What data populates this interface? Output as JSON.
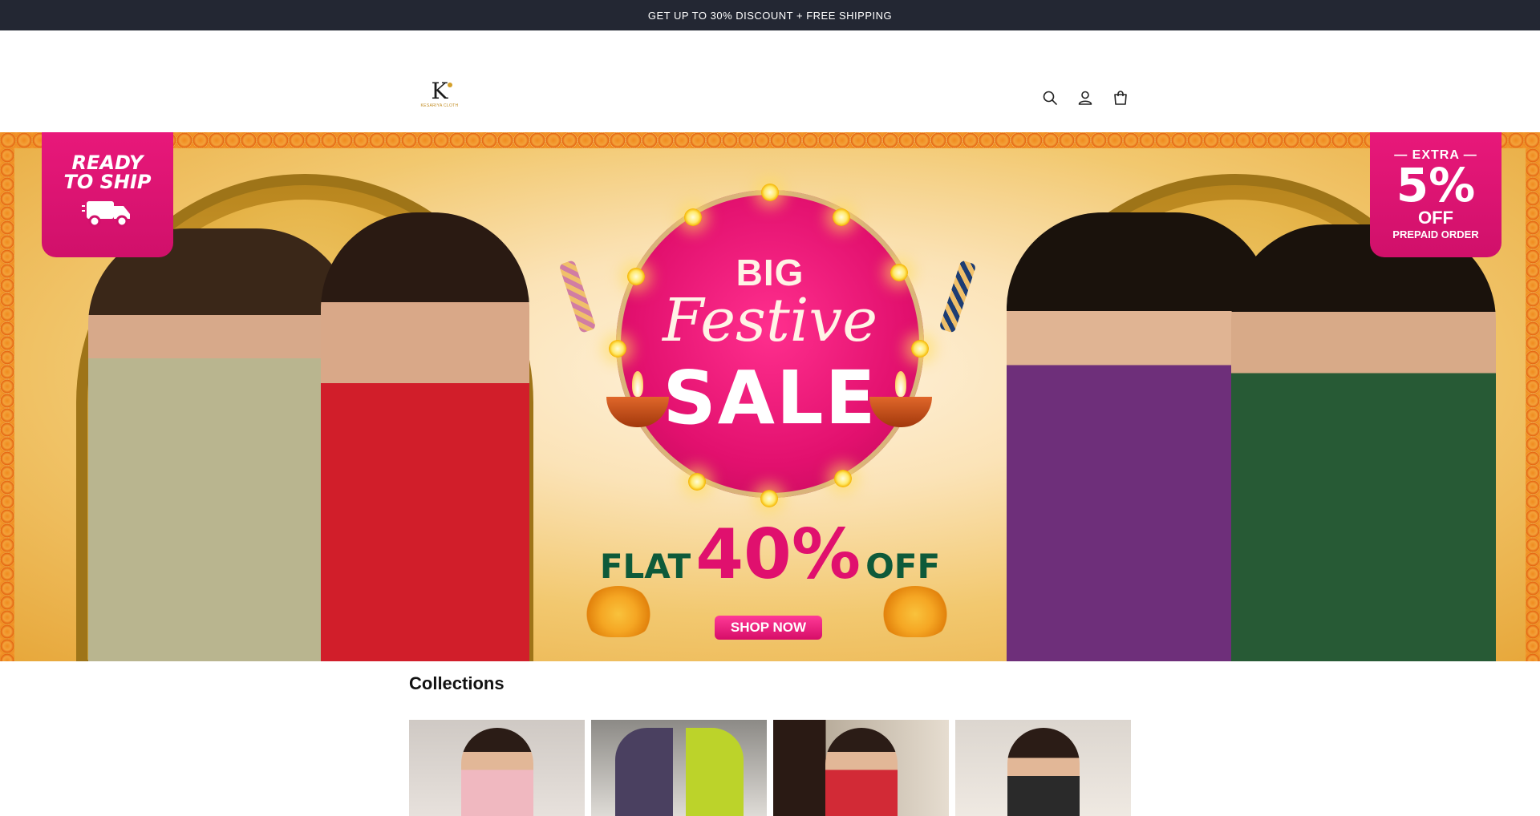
{
  "announcement": {
    "text": "GET UP TO 30% DISCOUNT + FREE SHIPPING"
  },
  "header": {
    "logo_monogram": "K",
    "logo_name": "KESARIYA CLOTH",
    "icons": [
      "search-icon",
      "account-icon",
      "cart-icon"
    ]
  },
  "banner": {
    "badge_left": {
      "line1": "READY",
      "line2": "TO SHIP"
    },
    "badge_right": {
      "extra": "— EXTRA —",
      "big": "5%",
      "off": "OFF",
      "note": "PREPAID ORDER"
    },
    "big": "BIG",
    "festive": "Festive",
    "sale": "SALE",
    "flat": "FLAT",
    "percent": "40%",
    "off": "OFF",
    "cta": "SHOP NOW",
    "colors": {
      "accent_pink": "#e0106e",
      "accent_green": "#0e5a3a",
      "marigold": "#f08a1e"
    }
  },
  "collections": {
    "title": "Collections"
  }
}
